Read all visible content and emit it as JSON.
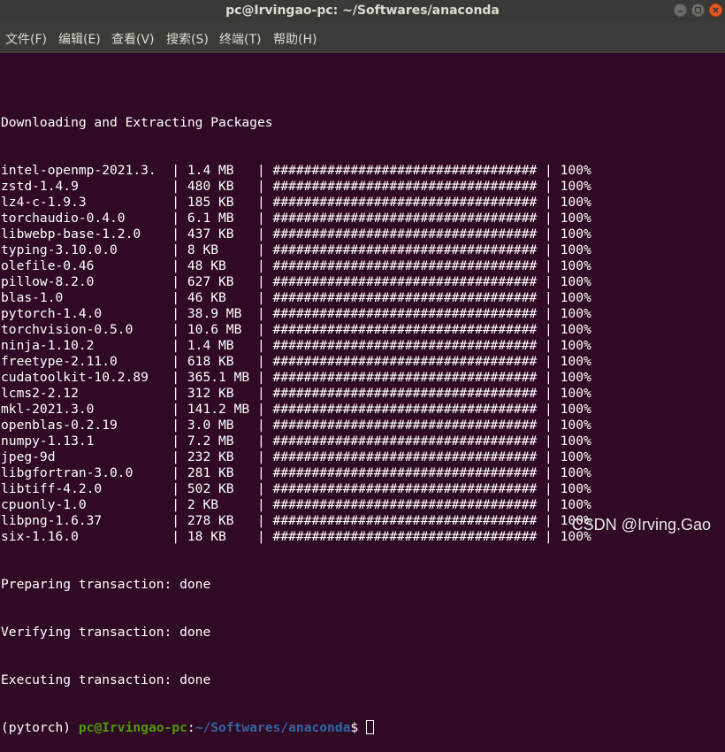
{
  "window": {
    "title": "pc@Irvingao-pc: ~/Softwares/anaconda",
    "close_icon": "close-icon",
    "minimize_icon": "minimize-icon",
    "maximize_icon": "maximize-icon",
    "close_color": "#e95420"
  },
  "menu": [
    {
      "label": "文件(F)"
    },
    {
      "label": "编辑(E)"
    },
    {
      "label": "查看(V)"
    },
    {
      "label": "搜索(S)"
    },
    {
      "label": "终端(T)"
    },
    {
      "label": "帮助(H)"
    }
  ],
  "terminal": {
    "background": "#300a24",
    "header": "Downloading and Extracting Packages",
    "packages": [
      {
        "name": "intel-openmp-2021.3.",
        "size": "1.4 MB",
        "bar": "##################################",
        "percent": "100%"
      },
      {
        "name": "zstd-1.4.9",
        "size": "480 KB",
        "bar": "##################################",
        "percent": "100%"
      },
      {
        "name": "lz4-c-1.9.3",
        "size": "185 KB",
        "bar": "##################################",
        "percent": "100%"
      },
      {
        "name": "torchaudio-0.4.0",
        "size": "6.1 MB",
        "bar": "##################################",
        "percent": "100%"
      },
      {
        "name": "libwebp-base-1.2.0",
        "size": "437 KB",
        "bar": "##################################",
        "percent": "100%"
      },
      {
        "name": "typing-3.10.0.0",
        "size": "8 KB",
        "bar": "##################################",
        "percent": "100%"
      },
      {
        "name": "olefile-0.46",
        "size": "48 KB",
        "bar": "##################################",
        "percent": "100%"
      },
      {
        "name": "pillow-8.2.0",
        "size": "627 KB",
        "bar": "##################################",
        "percent": "100%"
      },
      {
        "name": "blas-1.0",
        "size": "46 KB",
        "bar": "##################################",
        "percent": "100%"
      },
      {
        "name": "pytorch-1.4.0",
        "size": "38.9 MB",
        "bar": "##################################",
        "percent": "100%"
      },
      {
        "name": "torchvision-0.5.0",
        "size": "10.6 MB",
        "bar": "##################################",
        "percent": "100%"
      },
      {
        "name": "ninja-1.10.2",
        "size": "1.4 MB",
        "bar": "##################################",
        "percent": "100%"
      },
      {
        "name": "freetype-2.11.0",
        "size": "618 KB",
        "bar": "##################################",
        "percent": "100%"
      },
      {
        "name": "cudatoolkit-10.2.89",
        "size": "365.1 MB",
        "bar": "##################################",
        "percent": "100%"
      },
      {
        "name": "lcms2-2.12",
        "size": "312 KB",
        "bar": "##################################",
        "percent": "100%"
      },
      {
        "name": "mkl-2021.3.0",
        "size": "141.2 MB",
        "bar": "##################################",
        "percent": "100%"
      },
      {
        "name": "openblas-0.2.19",
        "size": "3.0 MB",
        "bar": "##################################",
        "percent": "100%"
      },
      {
        "name": "numpy-1.13.1",
        "size": "7.2 MB",
        "bar": "##################################",
        "percent": "100%"
      },
      {
        "name": "jpeg-9d",
        "size": "232 KB",
        "bar": "##################################",
        "percent": "100%"
      },
      {
        "name": "libgfortran-3.0.0",
        "size": "281 KB",
        "bar": "##################################",
        "percent": "100%"
      },
      {
        "name": "libtiff-4.2.0",
        "size": "502 KB",
        "bar": "##################################",
        "percent": "100%"
      },
      {
        "name": "cpuonly-1.0",
        "size": "2 KB",
        "bar": "##################################",
        "percent": "100%"
      },
      {
        "name": "libpng-1.6.37",
        "size": "278 KB",
        "bar": "##################################",
        "percent": "100%"
      },
      {
        "name": "six-1.16.0",
        "size": "18 KB",
        "bar": "##################################",
        "percent": "100%"
      }
    ],
    "status_lines": [
      "Preparing transaction: done",
      "Verifying transaction: done",
      "Executing transaction: done"
    ],
    "prompt": {
      "env": "(pytorch) ",
      "user_host": "pc@Irvingao-pc",
      "separator": ":",
      "path": "~/Softwares/anaconda",
      "symbol": "$ "
    }
  },
  "watermark": "CSDN @Irving.Gao"
}
